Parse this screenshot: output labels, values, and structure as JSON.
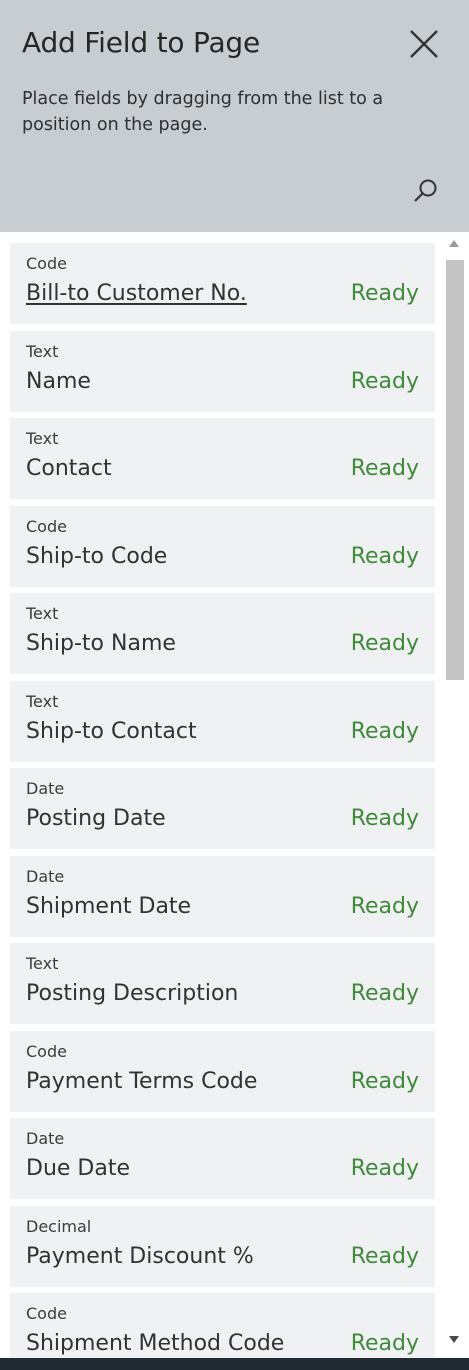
{
  "panel": {
    "title": "Add Field to Page",
    "description": "Place fields by dragging from the list to a position on the page.",
    "close_icon": "close-icon",
    "search_icon": "search-icon"
  },
  "fields": [
    {
      "type": "Code",
      "name": "Bill-to Customer No.",
      "status": "Ready"
    },
    {
      "type": "Text",
      "name": "Name",
      "status": "Ready"
    },
    {
      "type": "Text",
      "name": "Contact",
      "status": "Ready"
    },
    {
      "type": "Code",
      "name": "Ship-to Code",
      "status": "Ready"
    },
    {
      "type": "Text",
      "name": "Ship-to Name",
      "status": "Ready"
    },
    {
      "type": "Text",
      "name": "Ship-to Contact",
      "status": "Ready"
    },
    {
      "type": "Date",
      "name": "Posting Date",
      "status": "Ready"
    },
    {
      "type": "Date",
      "name": "Shipment Date",
      "status": "Ready"
    },
    {
      "type": "Text",
      "name": "Posting Description",
      "status": "Ready"
    },
    {
      "type": "Code",
      "name": "Payment Terms Code",
      "status": "Ready"
    },
    {
      "type": "Date",
      "name": "Due Date",
      "status": "Ready"
    },
    {
      "type": "Decimal",
      "name": "Payment Discount %",
      "status": "Ready"
    },
    {
      "type": "Code",
      "name": "Shipment Method Code",
      "status": "Ready"
    }
  ],
  "colors": {
    "header_bg": "#c8cdd2",
    "card_bg": "#f0f1f2",
    "status_ready": "#3f8a3a"
  }
}
